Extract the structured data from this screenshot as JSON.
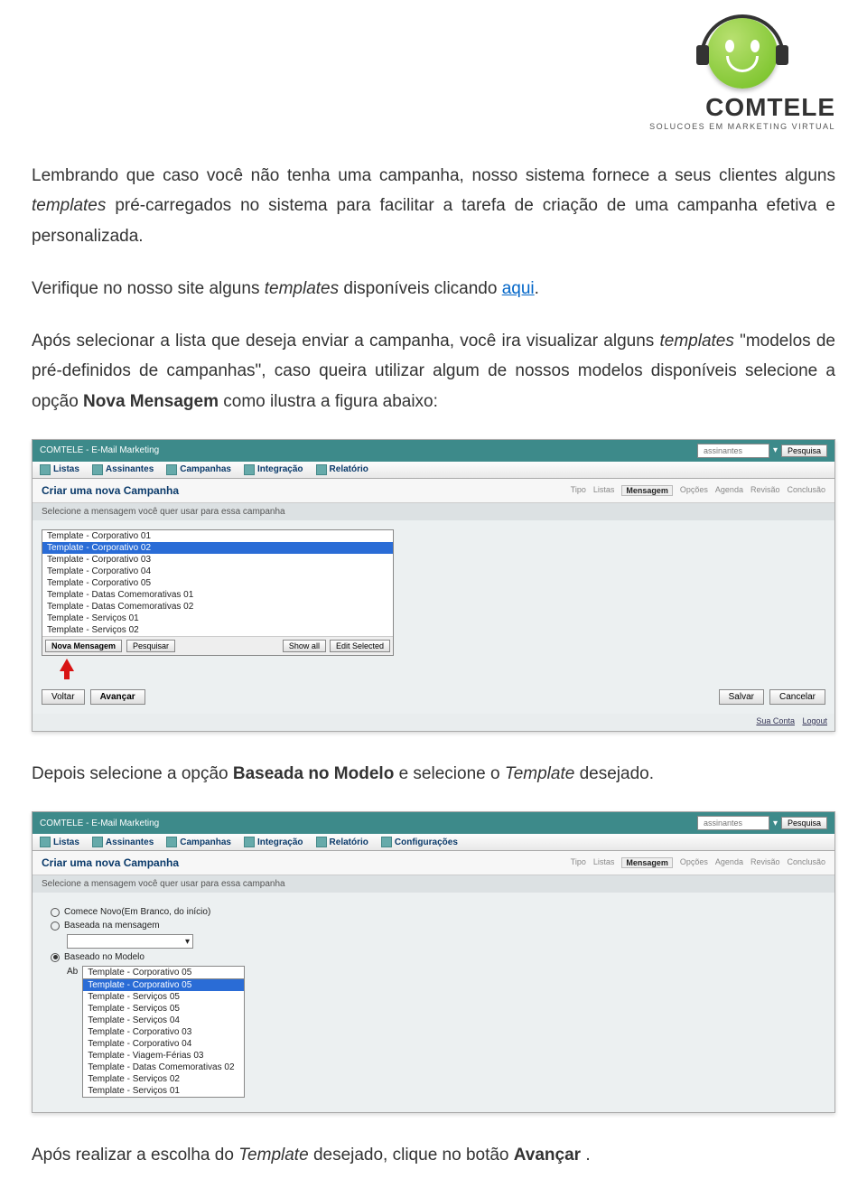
{
  "logo": {
    "name": "COMTELE",
    "tag": "SOLUCOES EM MARKETING VIRTUAL"
  },
  "p1_a": "Lembrando que caso você não tenha uma campanha, nosso sistema fornece a seus clientes alguns ",
  "p1_b": "templates",
  "p1_c": " pré-carregados no sistema para facilitar a tarefa de criação de uma campanha efetiva e personalizada.",
  "p2_a": "Verifique no nosso site alguns ",
  "p2_b": "templates",
  "p2_c": " disponíveis clicando ",
  "p2_link": "aqui",
  "p2_d": ".",
  "p3_a": "Após selecionar a lista que deseja enviar a campanha, você ira visualizar alguns ",
  "p3_b": "templates",
  "p3_c": " \"modelos de pré-definidos de campanhas\", caso queira utilizar algum de nossos modelos disponíveis selecione a opção ",
  "p3_bold": "Nova Mensagem",
  "p3_d": " como ilustra a figura abaixo:",
  "p4_a": "Depois selecione a opção ",
  "p4_b": "Baseada no Modelo",
  "p4_c": " e selecione o ",
  "p4_d": "Template",
  "p4_e": " desejado.",
  "p5_a": "Após realizar a escolha do ",
  "p5_b": "Template",
  "p5_c": " desejado, clique no botão ",
  "p5_d": "Avançar",
  "p5_e": ".",
  "app": {
    "brand": "COMTELE - E-Mail Marketing",
    "search_ph": "assinantes",
    "search_btn": "Pesquisa",
    "menu": [
      "Listas",
      "Assinantes",
      "Campanhas",
      "Integração",
      "Relatório"
    ],
    "menu2_extra": "Configurações",
    "page_title": "Criar uma nova Campanha",
    "wizard": [
      "Tipo",
      "Listas",
      "Mensagem",
      "Opções",
      "Agenda",
      "Revisão",
      "Conclusão"
    ],
    "subtitle": "Selecione a mensagem você quer usar para essa campanha",
    "list1": [
      "Template - Corporativo 01",
      "Template - Corporativo 02",
      "Template - Corporativo 03",
      "Template - Corporativo 04",
      "Template - Corporativo 05",
      "Template - Datas Comemorativas 01",
      "Template - Datas Comemorativas 02",
      "Template - Serviços 01",
      "Template - Serviços 02"
    ],
    "list1_sel": 1,
    "nova_msg": "Nova Mensagem",
    "pesquisar": "Pesquisar",
    "show_all": "Show all",
    "edit_sel": "Edit Selected",
    "voltar": "Voltar",
    "avancar": "Avançar",
    "salvar": "Salvar",
    "cancelar": "Cancelar",
    "foot1": "Sua Conta",
    "foot2": "Logout",
    "radio1": "Comece Novo(Em Branco, do início)",
    "radio2": "Baseada na mensagem",
    "radio2_sel": "",
    "radio3": "Baseado no Modelo",
    "radio3_prefix": "Ab",
    "list2_top": "Template - Corporativo 05",
    "list2": [
      "Template - Corporativo 05",
      "Template - Serviços 05",
      "Template - Serviços 05",
      "Template - Serviços 04",
      "Template - Corporativo 03",
      "Template - Corporativo 04",
      "Template - Viagem-Férias 03",
      "Template - Datas Comemorativas 02",
      "Template - Serviços 02",
      "Template - Serviços 01"
    ],
    "list2_sel": 0
  }
}
